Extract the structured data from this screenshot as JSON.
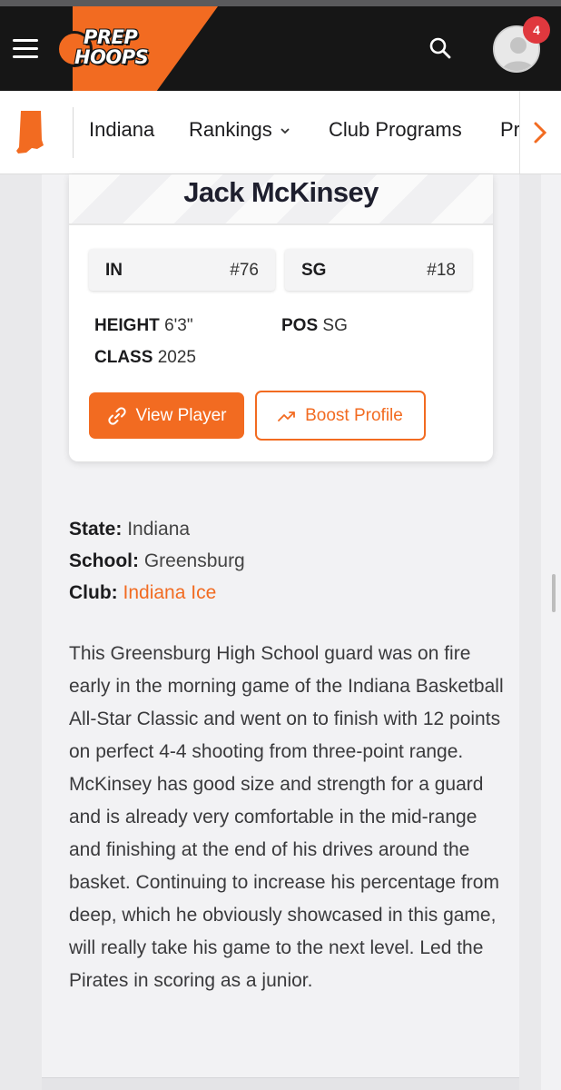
{
  "header": {
    "logo_line1": "PREP",
    "logo_line2": "HOOPS",
    "notification_count": "4",
    "colors": {
      "bar": "#161616",
      "accent": "#f26b21",
      "badge": "#e0383e"
    },
    "icons": [
      "menu-icon",
      "search-icon",
      "user-avatar-icon"
    ]
  },
  "state_nav": {
    "items": [
      {
        "label": "Indiana"
      },
      {
        "label": "Rankings"
      },
      {
        "label": "Club Programs"
      },
      {
        "label": "Pr"
      }
    ],
    "scroll_icon": "chevron-right-icon"
  },
  "player_card": {
    "name": "Jack McKinsey",
    "state_code": "IN",
    "state_rank": "#76",
    "position_code": "SG",
    "position_rank": "#18",
    "height_label": "HEIGHT",
    "height_value": "6'3\"",
    "pos_label": "POS",
    "pos_value": "SG",
    "class_label": "CLASS",
    "class_value": "2025",
    "view_button": "View Player",
    "boost_button": "Boost Profile"
  },
  "details": {
    "state_label": "State:",
    "state_value": "Indiana",
    "school_label": "School:",
    "school_value": "Greensburg",
    "club_label": "Club:",
    "club_value": "Indiana Ice"
  },
  "bio": "This Greensburg High School guard was on fire early in the morning game of the Indiana Basketball All-Star Classic and went on to finish with 12 points on perfect 4-4 shooting from three-point range. McKinsey has good size and strength for a guard and is already very comfortable in the mid-range and finishing at the end of his drives around the basket. Continuing to increase his percentage from deep, which he obviously showcased in this game, will really take his game to the next level. Led the Pirates in scoring as a junior."
}
